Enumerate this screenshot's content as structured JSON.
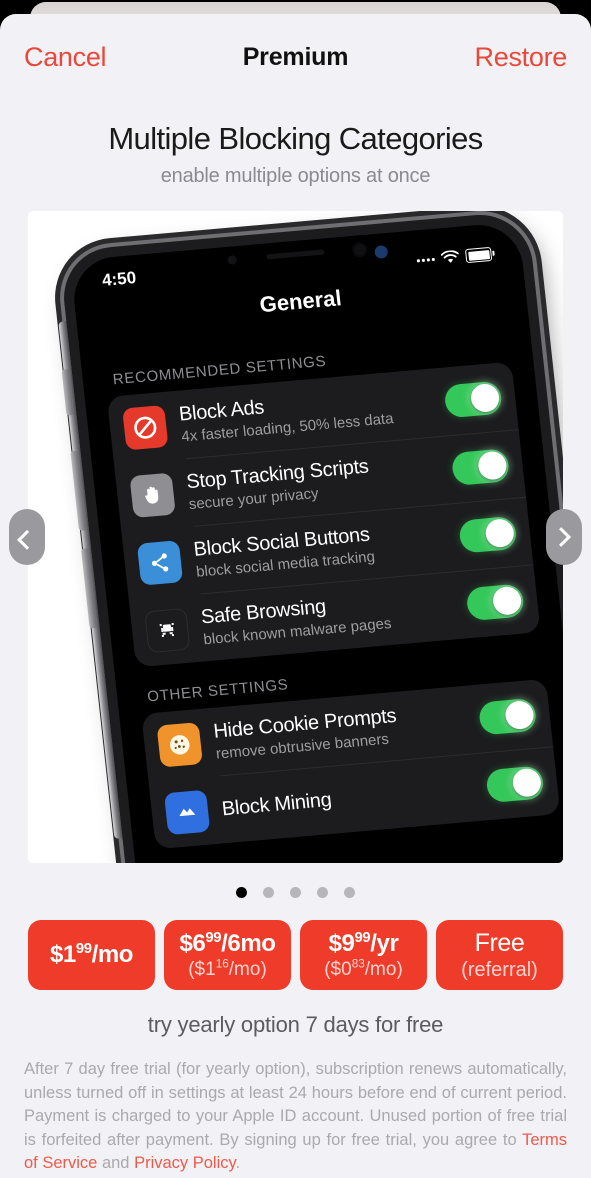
{
  "navbar": {
    "cancel_label": "Cancel",
    "title": "Premium",
    "restore_label": "Restore"
  },
  "hero": {
    "headline": "Multiple Blocking Categories",
    "subhead": "enable multiple options at once"
  },
  "carousel": {
    "prev_icon": "chevron-left-icon",
    "next_icon": "chevron-right-icon",
    "total_slides": 5,
    "active_slide": 1,
    "slide": {
      "phone": {
        "status_time": "4:50",
        "signal_icon": "cellular-signal-icon",
        "wifi_icon": "wifi-icon",
        "battery_icon": "battery-full-icon",
        "nav_title": "General",
        "sections": [
          {
            "header": "RECOMMENDED SETTINGS",
            "rows": [
              {
                "icon": "block-ads-icon",
                "icon_color": "#e5392c",
                "title": "Block Ads",
                "subtitle": "4x faster loading, 50% less data",
                "toggle": "on"
              },
              {
                "icon": "stop-hand-icon",
                "icon_color": "#8e8e93",
                "title": "Stop Tracking Scripts",
                "subtitle": "secure your privacy",
                "toggle": "on"
              },
              {
                "icon": "share-nodes-icon",
                "icon_color": "#3b8ed8",
                "title": "Block Social Buttons",
                "subtitle": "block social media tracking",
                "toggle": "on"
              },
              {
                "icon": "malware-invader-icon",
                "icon_color": "#1c1c1e",
                "title": "Safe Browsing",
                "subtitle": "block known malware pages",
                "toggle": "on"
              }
            ]
          },
          {
            "header": "OTHER SETTINGS",
            "rows": [
              {
                "icon": "cookie-icon",
                "icon_color": "#f0932b",
                "title": "Hide Cookie Prompts",
                "subtitle": "remove obtrusive banners",
                "toggle": "on"
              },
              {
                "icon": "block-mining-icon",
                "icon_color": "#2f6fe0",
                "title": "Block Mining",
                "subtitle": "",
                "toggle": "on"
              }
            ]
          }
        ]
      }
    }
  },
  "pricing": {
    "options": [
      {
        "main_pre": "$1",
        "main_sup": "99",
        "main_post": "/mo",
        "sub": ""
      },
      {
        "main_pre": "$6",
        "main_sup": "99",
        "main_post": "/6mo",
        "sub_pre": "($1",
        "sub_sup": "16",
        "sub_post": "/mo)"
      },
      {
        "main_pre": "$9",
        "main_sup": "99",
        "main_post": "/yr",
        "sub_pre": "($0",
        "sub_sup": "83",
        "sub_post": "/mo)"
      },
      {
        "main_pre": "Free",
        "main_sup": "",
        "main_post": "",
        "sub_pre": "(referral)",
        "sub_sup": "",
        "sub_post": ""
      }
    ],
    "accent_color": "#ee3b2a"
  },
  "trial_note": "try yearly option 7 days for free",
  "legal": {
    "body_before": "After 7 day free trial (for yearly option), subscription renews automatically, unless turned off in settings at least 24 hours before end of current period. Payment is charged to your Apple ID account. Unused portion of free trial is forfeited after payment. By signing up for free trial, you agree to ",
    "terms_link": "Terms of Service",
    "conjunction": " and ",
    "privacy_link": "Privacy Policy",
    "period": "."
  }
}
